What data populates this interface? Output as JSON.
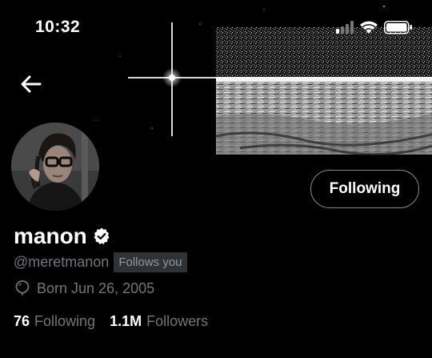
{
  "status_bar": {
    "time": "10:32"
  },
  "profile": {
    "display_name": "manon",
    "handle": "@meretmanon",
    "follows_you_badge": "Follows you",
    "born": "Born Jun 26, 2005",
    "follow_button_label": "Following",
    "following_count": "76",
    "following_label": "Following",
    "followers_count": "1.1M",
    "followers_label": "Followers"
  },
  "colors": {
    "background": "#000000",
    "muted_text": "#71767b",
    "badge_bg": "#2f3336",
    "verified": "#ffffff"
  },
  "icons": {
    "back": "arrow-left-icon",
    "verified": "verified-badge-icon",
    "birthday": "balloon-icon",
    "signal": "signal-icon",
    "wifi": "wifi-icon",
    "battery": "battery-icon"
  }
}
